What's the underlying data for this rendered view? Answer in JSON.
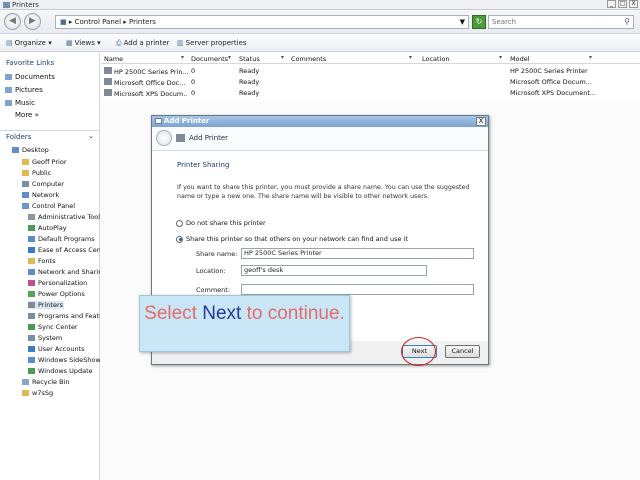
{
  "window": {
    "title": "Printers",
    "controls": [
      "_",
      "□",
      "X"
    ]
  },
  "nav": {
    "breadcrumb": [
      "Control Panel",
      "Printers"
    ],
    "search_placeholder": "Search"
  },
  "toolbar": {
    "organize": "Organize",
    "views": "Views",
    "add_printer": "Add a printer",
    "server_properties": "Server properties"
  },
  "sidebar": {
    "favorite_links_label": "Favorite Links",
    "favorites": [
      "Documents",
      "Pictures",
      "Music",
      "More"
    ],
    "folders_label": "Folders",
    "tree": [
      "Desktop",
      "Geoff Prior",
      "Public",
      "Computer",
      "Network",
      "Control Panel",
      "Administrative Tools",
      "AutoPlay",
      "Default Programs",
      "Ease of Access Cen",
      "Fonts",
      "Network and Sharin",
      "Personalization",
      "Power Options",
      "Printers",
      "Programs and Featu",
      "Sync Center",
      "System",
      "User Accounts",
      "Windows SideShow",
      "Windows Update",
      "Recycle Bin",
      "w7sSg"
    ]
  },
  "columns": [
    "Name",
    "Documents",
    "Status",
    "Comments",
    "Location",
    "Model"
  ],
  "printers": [
    {
      "name": "HP 2500C Series Prin...",
      "documents": "0",
      "status": "Ready",
      "model": "HP 2500C Series Printer"
    },
    {
      "name": "Microsoft Office Doc...",
      "documents": "0",
      "status": "Ready",
      "model": "Microsoft Office Docum..."
    },
    {
      "name": "Microsoft XPS Docum...",
      "documents": "0",
      "status": "Ready",
      "model": "Microsoft XPS Document..."
    }
  ],
  "dialog": {
    "title": "Add Printer",
    "header": "Add Printer",
    "heading": "Printer Sharing",
    "description": "If you want to share this printer, you must provide a share name. You can use the suggested name or type a new one. The share name will be visible to other network users.",
    "radio_no_share": "Do not share this printer",
    "radio_share": "Share this printer so that others on your network can find and use it",
    "share_name_label": "Share name:",
    "share_name_value": "HP 2500C Series Printer",
    "location_label": "Location:",
    "location_value": "geoff's desk",
    "comment_label": "Comment:",
    "comment_value": "",
    "next_button": "Next",
    "cancel_button": "Cancel",
    "close": "X"
  },
  "callout": {
    "prefix": "Select ",
    "keyword": "Next",
    "suffix": " to continue."
  }
}
